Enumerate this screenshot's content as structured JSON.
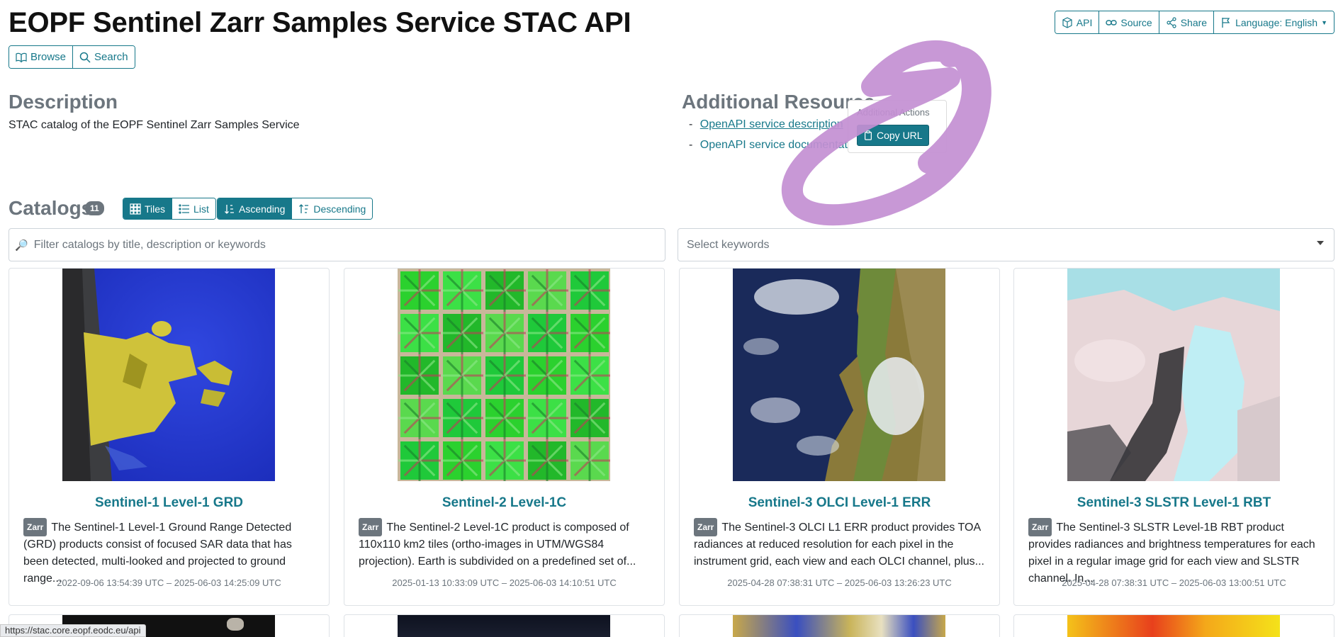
{
  "header": {
    "title": "EOPF Sentinel Zarr Samples Service STAC API",
    "nav": {
      "browse": "Browse",
      "search": "Search"
    },
    "actions": {
      "api": "API",
      "source": "Source",
      "share": "Share",
      "language": "Language: English"
    }
  },
  "description": {
    "heading": "Description",
    "text": "STAC catalog of the EOPF Sentinel Zarr Samples Service"
  },
  "resources": {
    "heading": "Additional Resource",
    "items": [
      {
        "bullet": "-",
        "label": "OpenAPI service description"
      },
      {
        "bullet": "-",
        "label": "OpenAPI service documentati"
      }
    ]
  },
  "popover": {
    "title": "Additional Actions",
    "copy_label": "Copy URL"
  },
  "catalogs": {
    "heading": "Catalogs",
    "count": "11",
    "view": {
      "tiles": "Tiles",
      "list": "List"
    },
    "sort": {
      "asc": "Ascending",
      "desc": "Descending"
    },
    "filter_placeholder": "Filter catalogs by title, description or keywords",
    "keywords_placeholder": "Select keywords",
    "items": [
      {
        "title": "Sentinel-1 Level-1 GRD",
        "badge": "Zarr",
        "description": "The Sentinel-1 Level-1 Ground Range Detected (GRD) products consist of focused SAR data that has been detected, multi-looked and projected to ground range...",
        "dates": "2022-09-06 13:54:39 UTC – 2025-06-03 14:25:09 UTC"
      },
      {
        "title": "Sentinel-2 Level-1C",
        "badge": "Zarr",
        "description": "The Sentinel-2 Level-1C product is composed of 110x110 km2 tiles (ortho-images in UTM/WGS84 projection). Earth is subdivided on a predefined set of...",
        "dates": "2025-01-13 10:33:09 UTC – 2025-06-03 14:10:51 UTC"
      },
      {
        "title": "Sentinel-3 OLCI Level-1 ERR",
        "badge": "Zarr",
        "description": "The Sentinel-3 OLCI L1 ERR product provides TOA radiances at reduced resolution for each pixel in the instrument grid, each view and each OLCI channel, plus...",
        "dates": "2025-04-28 07:38:31 UTC – 2025-06-03 13:26:23 UTC"
      },
      {
        "title": "Sentinel-3 SLSTR Level-1 RBT",
        "badge": "Zarr",
        "description": "The Sentinel-3 SLSTR Level-1B RBT product provides radiances and brightness temperatures for each pixel in a regular image grid for each view and SLSTR channel. In...",
        "dates": "2025-04-28 07:38:31 UTC – 2025-06-03 13:00:51 UTC"
      }
    ]
  },
  "status_bar": {
    "url": "https://stac.core.eopf.eodc.eu/api"
  },
  "colors": {
    "accent": "#17788a",
    "badge": "#6c757d",
    "highlight": "#c38fd2"
  }
}
